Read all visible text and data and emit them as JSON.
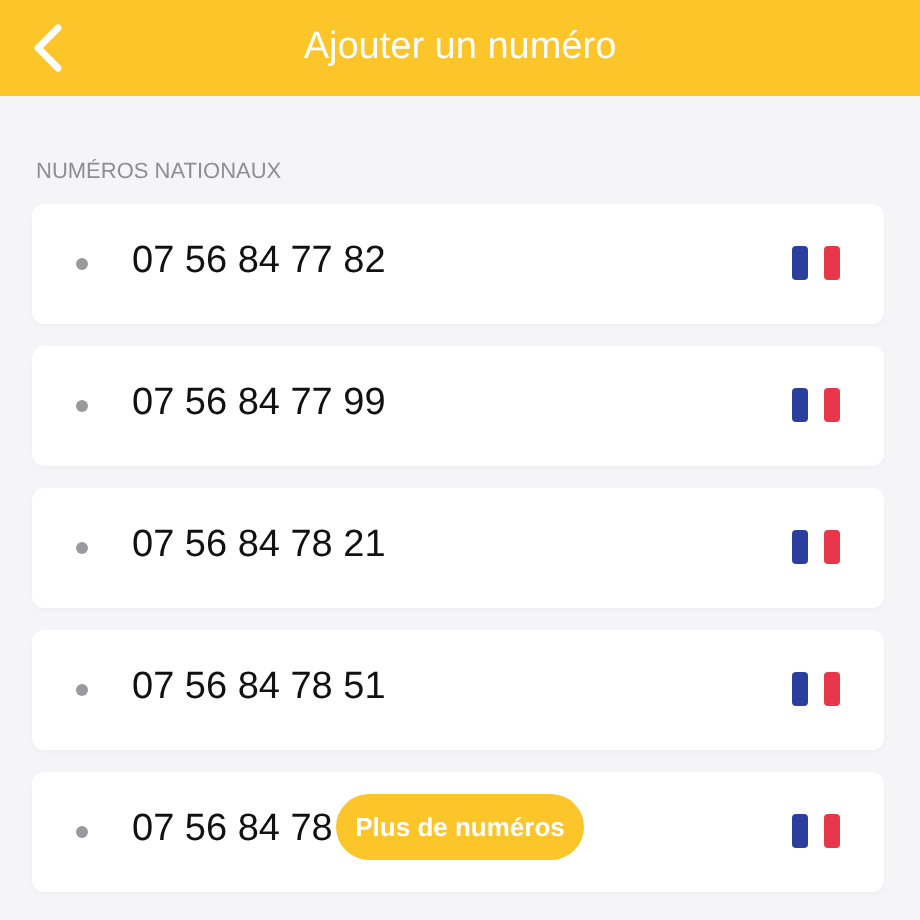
{
  "header": {
    "title": "Ajouter un numéro"
  },
  "section": {
    "label": "NUMÉROS NATIONAUX"
  },
  "numbers": [
    {
      "number": "07 56 84 77 82"
    },
    {
      "number": "07 56 84 77 99"
    },
    {
      "number": "07 56 84 78 21"
    },
    {
      "number": "07 56 84 78 51"
    },
    {
      "number": "07 56 84 78"
    }
  ],
  "more_button": {
    "label": "Plus de numéros"
  }
}
